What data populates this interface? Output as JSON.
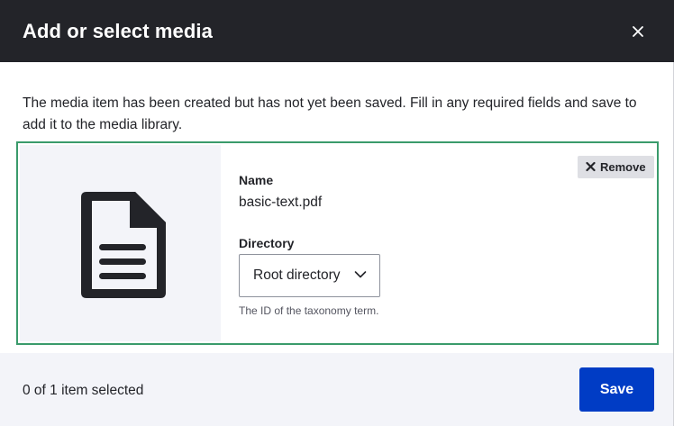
{
  "dialog": {
    "title": "Add or select media",
    "close_icon": "close-icon",
    "message": "The media item has been created but has not yet been saved. Fill in any required fields and save to add it to the media library."
  },
  "media_item": {
    "preview_icon": "document-icon",
    "remove_label": "Remove",
    "name_label": "Name",
    "name_value": "basic-text.pdf",
    "directory_label": "Directory",
    "directory_selected": "Root directory",
    "directory_description": "The ID of the taxonomy term."
  },
  "footer": {
    "selection_count": "0 of 1 item selected",
    "save_label": "Save"
  },
  "colors": {
    "titlebar": "#232429",
    "accent_border": "#3a9b6b",
    "primary_button": "#003cc5",
    "footer_bg": "#f3f4f9"
  }
}
